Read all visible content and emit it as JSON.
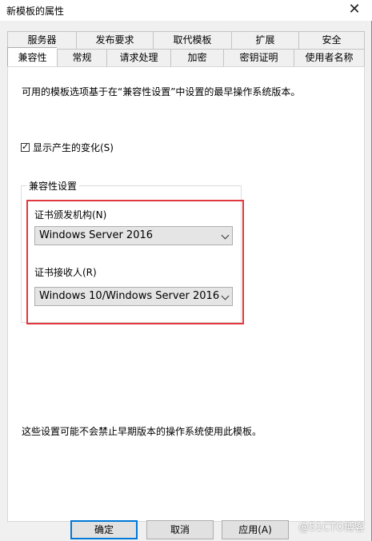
{
  "window": {
    "title": "新模板的属性",
    "close_glyph": "✕"
  },
  "tabs": {
    "back_row": [
      "服务器",
      "发布要求",
      "取代模板",
      "扩展",
      "安全"
    ],
    "front_row": [
      "兼容性",
      "常规",
      "请求处理",
      "加密",
      "密钥证明",
      "使用者名称"
    ],
    "active": "兼容性"
  },
  "compat": {
    "description": "可用的模板选项基于在“兼容性设置”中设置的最早操作系统版本。",
    "show_changes_label": "显示产生的变化(S)",
    "show_changes_checked": true,
    "group_label": "兼容性设置",
    "issuer_label": "证书颁发机构(N)",
    "issuer_value": "Windows Server 2016",
    "recipient_label": "证书接收人(R)",
    "recipient_value": "Windows 10/Windows Server 2016",
    "footer_note": "这些设置可能不会禁止早期版本的操作系统使用此模板。"
  },
  "buttons": {
    "ok": "确定",
    "cancel": "取消",
    "apply": "应用(A)"
  },
  "watermark": "@51CTO博客",
  "colors": {
    "highlight_box": "#e0383e",
    "default_button_border": "#0078d7"
  }
}
